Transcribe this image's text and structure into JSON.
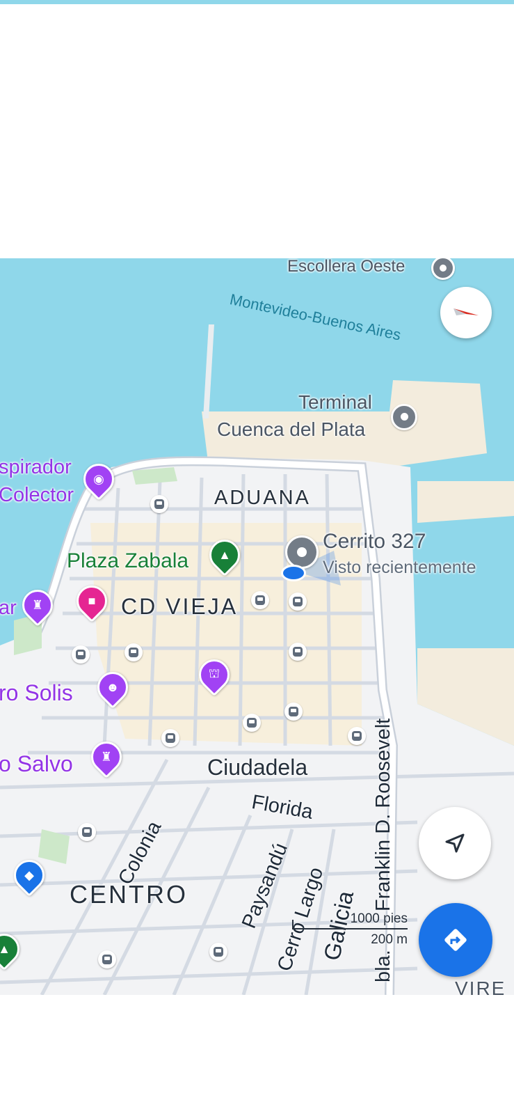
{
  "top_sheet": {
    "bg": "#ffffff"
  },
  "labels": {
    "escollera": "Escollera Oeste",
    "route": "Montevideo-Buenos Aires",
    "terminal_line1": "Terminal",
    "terminal_line2": "Cuenca del Plata",
    "mirador1": "spirador",
    "mirador2": "Colector",
    "aduana": "ADUANA",
    "plaza_zabala": "Plaza Zabala",
    "cd_vieja": "CD VIEJA",
    "place_name": "Cerrito 327",
    "place_sub": "Visto recientemente",
    "left_ar": "ar",
    "teatro_solis": "ro Solis",
    "palacio_salvo": "o Salvo",
    "ciudadela": "Ciudadela",
    "florida": "Florida",
    "colonia": "Colonia",
    "centro": "CENTRO",
    "paysandu": "Paysandú",
    "cerro_largo": "Cerro Largo",
    "galicia": "Galicia",
    "roosevelt": "Franklin D. Roosevelt",
    "rambla": "bla.",
    "corner": "VIRE"
  },
  "scale": {
    "ft": "1000 pies",
    "m": "200 m"
  },
  "icons": {
    "compass": "compass-icon",
    "locate": "my-location-icon",
    "directions": "directions-icon"
  },
  "colors": {
    "water": "#8fd7ea",
    "land": "#f2f3f5",
    "accent": "#1a73e8",
    "purple": "#a142f4",
    "green": "#188038"
  }
}
